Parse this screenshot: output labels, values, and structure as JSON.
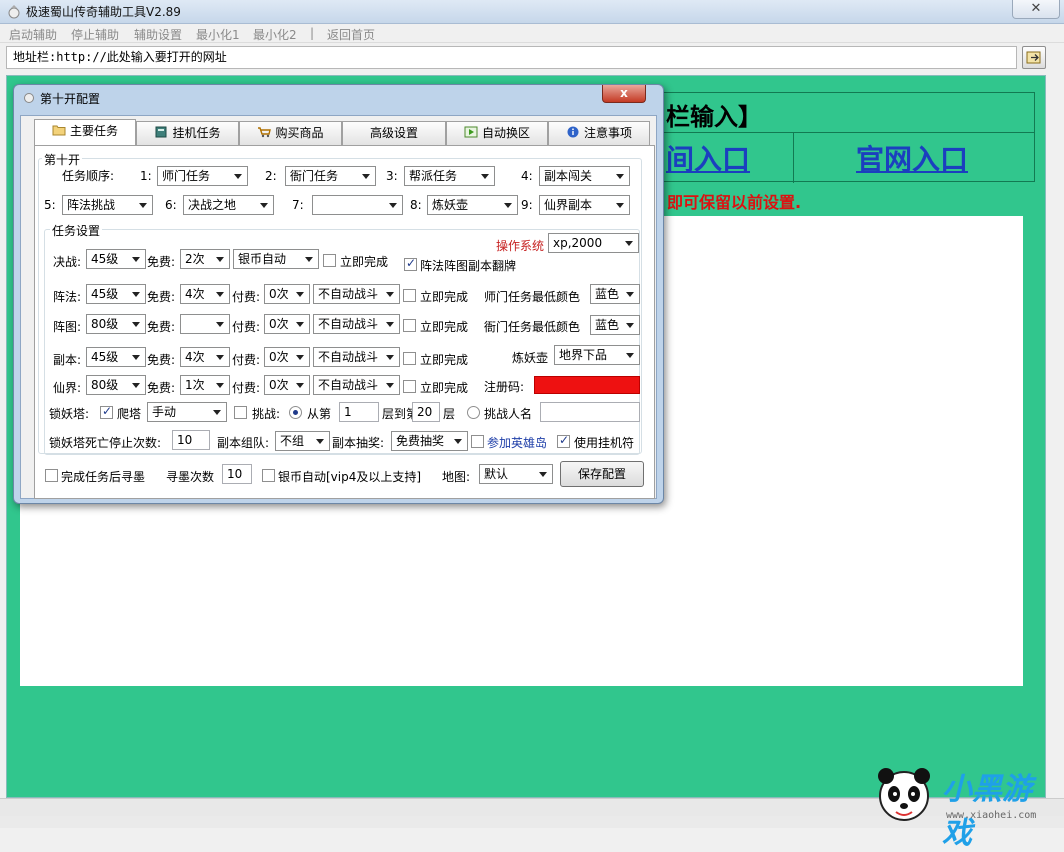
{
  "window": {
    "title": "极速蜀山传奇辅助工具V2.89",
    "close_label": "✕"
  },
  "menu": {
    "items": [
      "启动辅助",
      "停止辅助",
      "辅助设置",
      "最小化1",
      "最小化2",
      "|",
      "返回首页"
    ]
  },
  "address": {
    "value": "地址栏:http://此处输入要打开的网址"
  },
  "browser": {
    "banner_text": "栏输入】",
    "entry_left": "间入口",
    "entry_right": "官网入口",
    "notice": "即可保留以前设置."
  },
  "watermark": {
    "brand": "小黑游戏",
    "url": "www.xiaohei.com"
  },
  "dialog": {
    "title": "第十开配置",
    "close_label": "x",
    "tabs": [
      {
        "label": "主要任务",
        "icon": "folder-icon"
      },
      {
        "label": "挂机任务",
        "icon": "book-icon"
      },
      {
        "label": "购买商品",
        "icon": "cart-icon"
      },
      {
        "label": "高级设置",
        "icon": ""
      },
      {
        "label": "自动换区",
        "icon": "play-icon"
      },
      {
        "label": "注意事项",
        "icon": "info-icon"
      }
    ],
    "group_main": "第十开",
    "order_label": "任务顺序:",
    "order": [
      {
        "num": "1:",
        "value": "师门任务"
      },
      {
        "num": "2:",
        "value": "衙门任务"
      },
      {
        "num": "3:",
        "value": "帮派任务"
      },
      {
        "num": "4:",
        "value": "副本闯关"
      },
      {
        "num": "5:",
        "value": "阵法挑战"
      },
      {
        "num": "6:",
        "value": "决战之地"
      },
      {
        "num": "7:",
        "value": ""
      },
      {
        "num": "8:",
        "value": "炼妖壶"
      },
      {
        "num": "9:",
        "value": "仙界副本"
      }
    ],
    "group_task": "任务设置",
    "os_label": "操作系统",
    "os_value": "xp,2000",
    "rows": [
      {
        "label": "决战:",
        "level": "45级",
        "free_label": "免费:",
        "free": "2次",
        "pay_label": "",
        "pay": "",
        "fight": "银币自动",
        "instant": "立即完成"
      },
      {
        "label": "阵法:",
        "level": "45级",
        "free_label": "免费:",
        "free": "4次",
        "pay_label": "付费:",
        "pay": "0次",
        "fight": "不自动战斗",
        "instant": "立即完成"
      },
      {
        "label": "阵图:",
        "level": "80级",
        "free_label": "免费:",
        "free": "",
        "pay_label": "付费:",
        "pay": "0次",
        "fight": "不自动战斗",
        "instant": "立即完成"
      },
      {
        "label": "副本:",
        "level": "45级",
        "free_label": "免费:",
        "free": "4次",
        "pay_label": "付费:",
        "pay": "0次",
        "fight": "不自动战斗",
        "instant": "立即完成"
      },
      {
        "label": "仙界:",
        "level": "80级",
        "free_label": "免费:",
        "free": "1次",
        "pay_label": "付费:",
        "pay": "0次",
        "fight": "不自动战斗",
        "instant": "立即完成"
      }
    ],
    "flip_label": "阵法阵图副本翻牌",
    "shimen_color_label": "师门任务最低颜色",
    "shimen_color": "蓝色",
    "yamen_color_label": "衙门任务最低颜色",
    "yamen_color": "蓝色",
    "lianyao_label": "炼妖壶",
    "lianyao_value": "地界下品",
    "reg_label": "注册码:",
    "tower_label": "锁妖塔:",
    "climb_label": "爬塔",
    "climb_mode": "手动",
    "challenge_label": "挑战:",
    "from_label": "从第",
    "from_value": "1",
    "to_label": "层到第",
    "to_value": "20",
    "floor_label": "层",
    "challenge_person_label": "挑战人名",
    "challenge_person": "",
    "death_label": "锁妖塔死亡停止次数:",
    "death_value": "10",
    "team_label": "副本组队:",
    "team_value": "不组",
    "lottery_label": "副本抽奖:",
    "lottery_value": "免费抽奖",
    "hero_island": "参加英雄岛",
    "use_charm": "使用挂机符",
    "after_task": "完成任务后寻墨",
    "seek_label": "寻墨次数",
    "seek_value": "10",
    "silver_auto": "银币自动[vip4及以上支持]",
    "map_label": "地图:",
    "map_value": "默认",
    "save_button": "保存配置"
  }
}
